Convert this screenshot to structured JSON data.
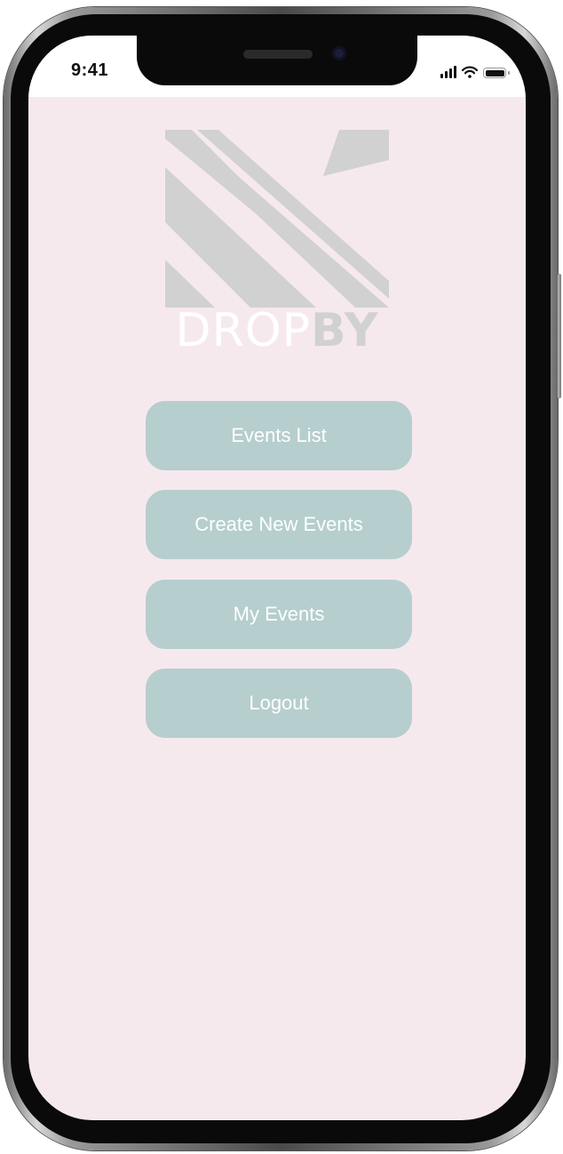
{
  "status_bar": {
    "time": "9:41",
    "icons": [
      "signal-icon",
      "wifi-icon",
      "battery-icon"
    ]
  },
  "logo": {
    "word_light": "DROP",
    "word_bold": "BY"
  },
  "menu": {
    "items": [
      {
        "label": "Events List"
      },
      {
        "label": "Create New Events"
      },
      {
        "label": "My Events"
      },
      {
        "label": "Logout"
      }
    ]
  },
  "colors": {
    "screen_background": "#f6e9ee",
    "button_background": "#b6cece",
    "button_text": "#ffffff",
    "logo_gray": "#d1d1d1"
  }
}
